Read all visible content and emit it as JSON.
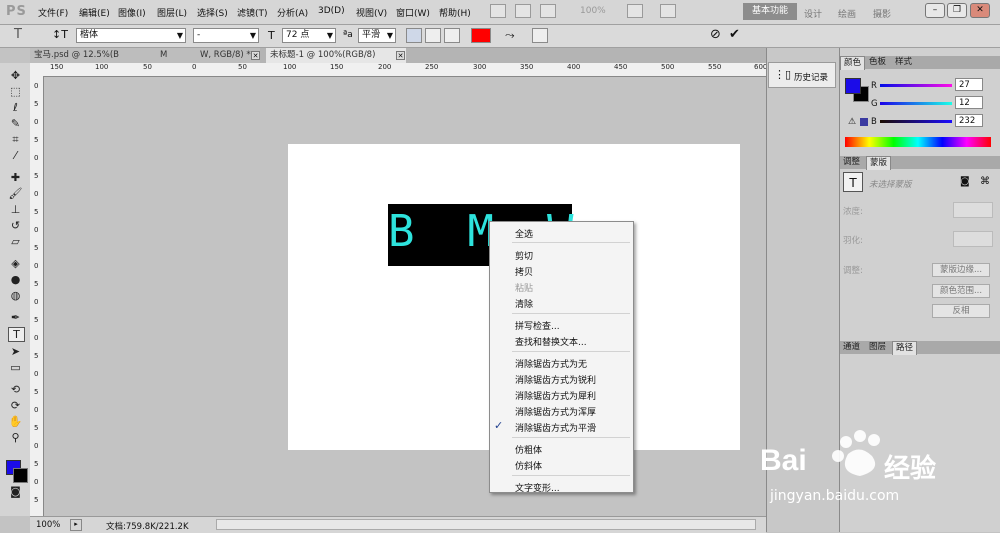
{
  "app": {
    "logo": "PS"
  },
  "menubar": {
    "items": [
      "文件(F)",
      "编辑(E)",
      "图像(I)",
      "图层(L)",
      "选择(S)",
      "滤镜(T)",
      "分析(A)",
      "3D(D)",
      "视图(V)",
      "窗口(W)",
      "帮助(H)"
    ],
    "zoom": "100%",
    "workspaces": {
      "active": "基本功能",
      "others": [
        "设计",
        "绘画",
        "摄影"
      ]
    }
  },
  "options": {
    "tool_glyph": "T",
    "font_family": "楷体",
    "font_style": "-",
    "font_size": "72 点",
    "antialias": "平滑",
    "text_color": "#ff0000"
  },
  "tabs": [
    {
      "label": "宝马.psd @ 12.5%(B",
      "extra": "M",
      "extra2": "W, RGB/8) *"
    },
    {
      "label": "未标题-1 @ 100%(RGB/8)"
    }
  ],
  "ruler_top_labels": [
    "150",
    "100",
    "50",
    "0",
    "50",
    "100",
    "150",
    "200",
    "250",
    "300",
    "350",
    "400",
    "450",
    "500",
    "550",
    "600"
  ],
  "ruler_left_labels": [
    "0",
    "5",
    "0",
    "5",
    "0",
    "5",
    "0",
    "5",
    "0",
    "5",
    "0",
    "5",
    "0",
    "5",
    "0",
    "5",
    "0",
    "5",
    "0",
    "5",
    "0",
    "5",
    "0",
    "5"
  ],
  "canvas": {
    "text": "B  M  W",
    "text_color": "#2ee3dd",
    "bg": "#000000"
  },
  "context_menu": {
    "items": [
      {
        "label": "全选",
        "disabled": false
      },
      {
        "label": "剪切",
        "disabled": false
      },
      {
        "label": "拷贝",
        "disabled": false
      },
      {
        "label": "粘贴",
        "disabled": true
      },
      {
        "label": "清除",
        "disabled": false
      },
      {
        "label": "拼写检查...",
        "disabled": false
      },
      {
        "label": "查找和替换文本...",
        "disabled": false
      },
      {
        "label": "消除锯齿方式为无",
        "disabled": false
      },
      {
        "label": "消除锯齿方式为锐利",
        "disabled": false
      },
      {
        "label": "消除锯齿方式为犀利",
        "disabled": false
      },
      {
        "label": "消除锯齿方式为浑厚",
        "disabled": false
      },
      {
        "label": "消除锯齿方式为平滑",
        "disabled": false,
        "checked": true
      },
      {
        "label": "仿粗体",
        "disabled": false
      },
      {
        "label": "仿斜体",
        "disabled": false
      },
      {
        "label": "文字变形...",
        "disabled": false
      }
    ],
    "check_mark": "✓"
  },
  "status": {
    "zoom": "100%",
    "doc": "文档:759.8K/221.2K"
  },
  "history": {
    "label": "历史记录"
  },
  "color_panel": {
    "tabs": [
      "颜色",
      "色板",
      "样式"
    ],
    "fg": "#1b0ce8",
    "bg": "#000000",
    "channels": [
      {
        "name": "R",
        "value": "27"
      },
      {
        "name": "G",
        "value": "12"
      },
      {
        "name": "B",
        "value": "232"
      }
    ]
  },
  "mask_panel": {
    "tabs": [
      "调整",
      "蒙版"
    ],
    "title": "未选择蒙版",
    "density_label": "浓度:",
    "feather_label": "羽化:",
    "adjust_label": "调整:",
    "buttons": [
      "蒙版边缘...",
      "颜色范围...",
      "反相"
    ]
  },
  "layers_panel": {
    "tabs": [
      "通道",
      "图层",
      "路径"
    ]
  },
  "watermark": {
    "text1": "Bai",
    "text2": "经验",
    "url": "jingyan.baidu.com"
  }
}
